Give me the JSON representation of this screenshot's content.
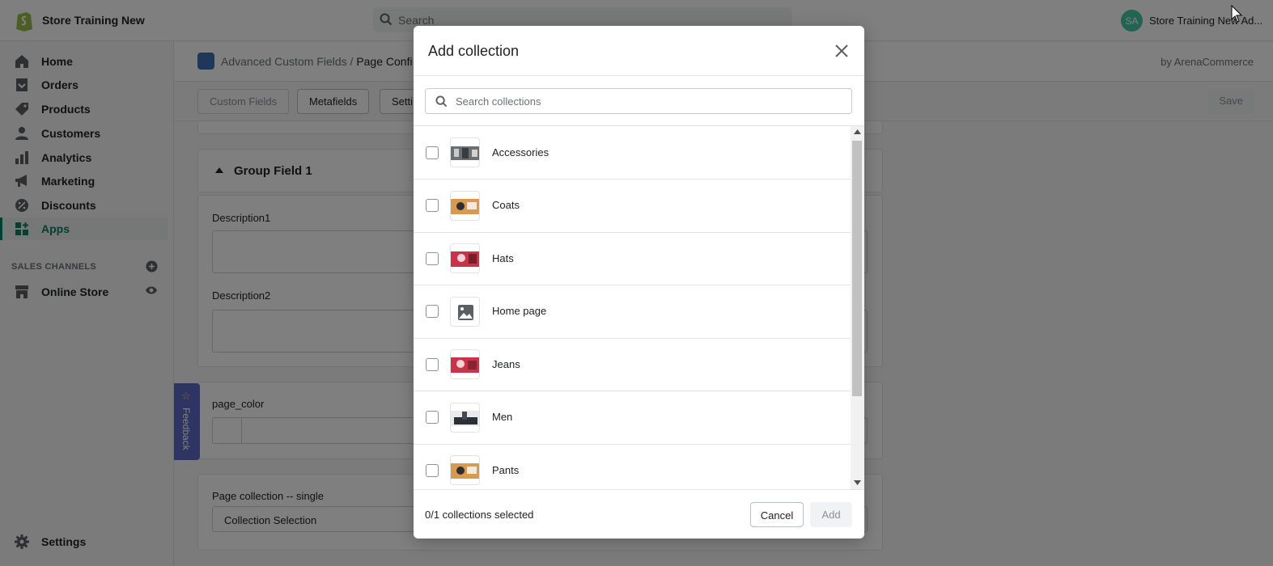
{
  "topbar": {
    "store_name": "Store Training New",
    "search_placeholder": "Search",
    "avatar_initials": "SA",
    "account_name": "Store Training New Ad..."
  },
  "sidebar": {
    "items": [
      {
        "label": "Home",
        "icon": "home-icon"
      },
      {
        "label": "Orders",
        "icon": "orders-icon"
      },
      {
        "label": "Products",
        "icon": "tag-icon"
      },
      {
        "label": "Customers",
        "icon": "person-icon"
      },
      {
        "label": "Analytics",
        "icon": "bar-chart-icon"
      },
      {
        "label": "Marketing",
        "icon": "megaphone-icon"
      },
      {
        "label": "Discounts",
        "icon": "discount-icon"
      },
      {
        "label": "Apps",
        "icon": "apps-icon",
        "active": true
      }
    ],
    "sales_channels_heading": "SALES CHANNELS",
    "online_store": "Online Store",
    "settings": "Settings",
    "feedback": "Feedback"
  },
  "app": {
    "breadcrumb_app": "Advanced Custom Fields",
    "breadcrumb_sep": "/",
    "breadcrumb_page": "Page Confi",
    "by": "by ArenaCommerce",
    "tabs": [
      "Custom Fields",
      "Metafields",
      "Setti"
    ],
    "save": "Save",
    "group_title": "Group Field 1",
    "fields": {
      "description1": "Description1",
      "description2": "Description2",
      "page_color": "page_color",
      "page_collection": "Page collection -- single",
      "collection_selection": "Collection Selection"
    }
  },
  "modal": {
    "title": "Add collection",
    "search_placeholder": "Search collections",
    "collections": [
      {
        "label": "Accessories"
      },
      {
        "label": "Coats"
      },
      {
        "label": "Hats"
      },
      {
        "label": "Home page"
      },
      {
        "label": "Jeans"
      },
      {
        "label": "Men"
      },
      {
        "label": "Pants"
      }
    ],
    "selected_count": "0/1 collections selected",
    "cancel": "Cancel",
    "add": "Add"
  },
  "colors": {
    "accent": "#008060",
    "overlay": "rgba(0,0,0,0.5)",
    "feedback": "#5c6ac4"
  }
}
